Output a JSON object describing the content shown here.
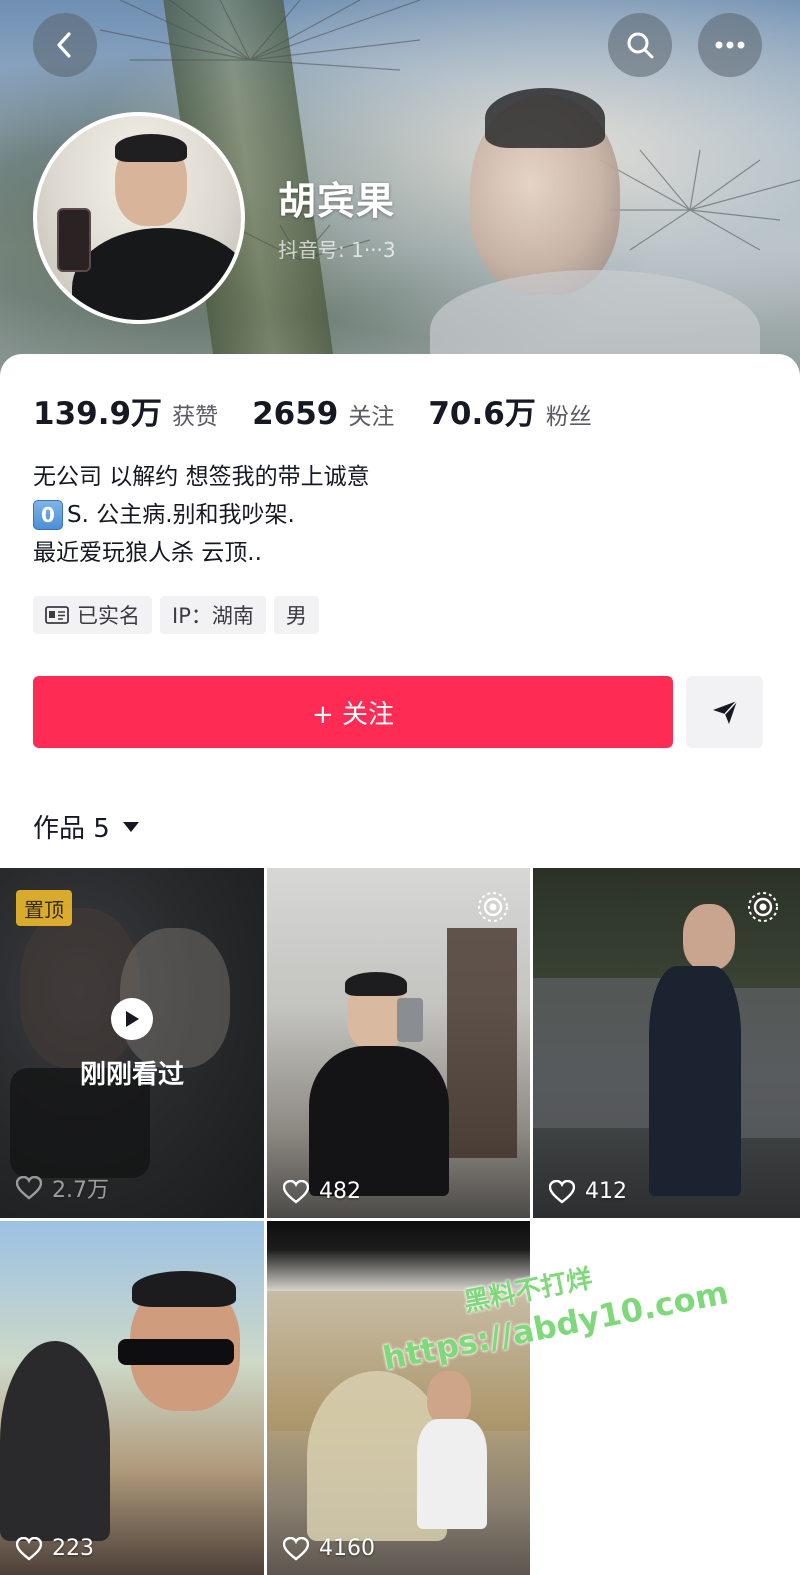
{
  "profile": {
    "name": "胡宾果",
    "douyin_id_label": "抖音号: ",
    "douyin_id_value": "1···3"
  },
  "stats": [
    {
      "value": "139.9万",
      "label": "获赞"
    },
    {
      "value": "2659",
      "label": "关注"
    },
    {
      "value": "70.6万",
      "label": "粉丝"
    }
  ],
  "bio": {
    "line1": "无公司 以解约 想签我的带上诚意",
    "keycap": "0",
    "line2": "S. 公主病.别和我吵架.",
    "line3": "最近爱玩狼人杀 云顶.."
  },
  "tags": {
    "verified": "已实名",
    "ip": "IP：湖南",
    "gender": "男"
  },
  "actions": {
    "follow_label": "+ 关注"
  },
  "works": {
    "header": "作品 5"
  },
  "tiles": [
    {
      "pinned_label": "置顶",
      "overlay_label": "刚刚看过",
      "likes": "2.7万"
    },
    {
      "likes": "482"
    },
    {
      "likes": "412"
    },
    {
      "likes": "223"
    },
    {
      "likes": "4160"
    }
  ],
  "watermark": {
    "line1": "黑料不打烊",
    "line2": "https://abdy10.com"
  },
  "icons": {
    "back": "chevron-left-icon",
    "search": "search-icon",
    "more": "more-dots-icon",
    "message": "send-icon",
    "heart": "heart-icon",
    "live": "live-ring-icon",
    "play": "play-icon",
    "id_card": "id-card-icon",
    "caret": "caret-down-icon"
  },
  "colors": {
    "accent": "#fe2c55",
    "text": "#161823",
    "muted": "#5b5c63",
    "tag_bg": "#f2f2f4",
    "pin": "#f7c12d",
    "watermark": "#7fd97a"
  }
}
